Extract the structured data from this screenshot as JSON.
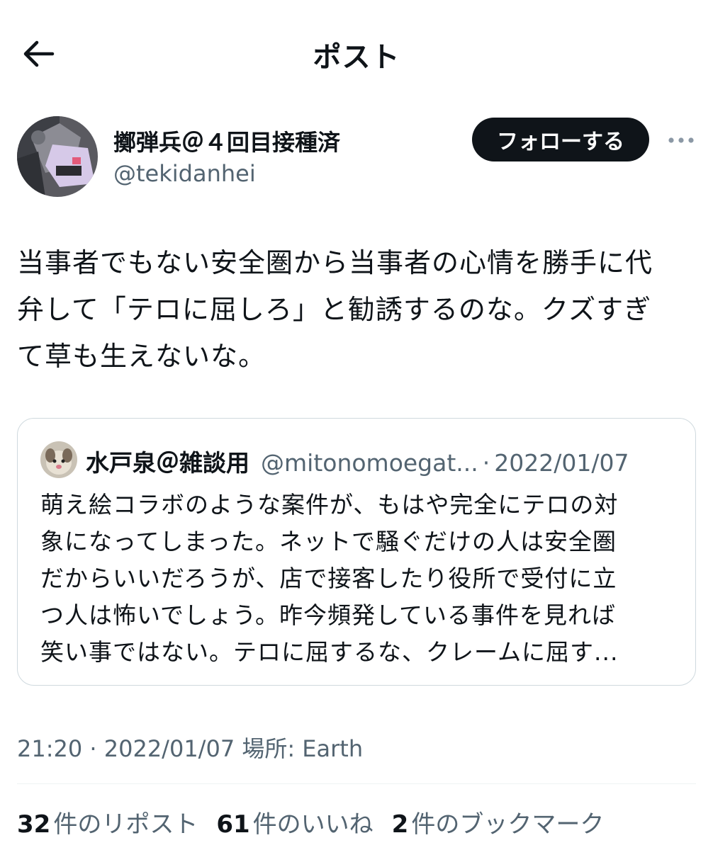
{
  "header": {
    "title": "ポスト",
    "back_icon": "arrow-left-icon"
  },
  "author": {
    "display_name": "擲弾兵＠４回目接種済",
    "handle": "@tekidanhei",
    "follow_label": "フォローする",
    "more_icon": "more-horizontal-icon"
  },
  "tweet": {
    "lines": [
      "当事者でもない安全圏から当事者の心情を勝手に代",
      "弁して「テロに屈しろ」と勧誘するのな。クズすぎ",
      "て草も生えないな。"
    ]
  },
  "quote": {
    "display_name": "水戸泉＠雑談用",
    "handle": "@mitonomoegat...",
    "separator": "·",
    "date": "2022/01/07",
    "lines": [
      "萌え絵コラボのような案件が、もはや完全にテロの対",
      "象になってしまった。ネットで騒ぐだけの人は安全圏",
      "だからいいだろうが、店で接客したり役所で受付に立",
      "つ人は怖いでしょう。昨今頻発している事件を見れば",
      "笑い事ではない。テロに屈するな、クレームに屈す..."
    ]
  },
  "meta": {
    "time": "21:20",
    "separator": "·",
    "date": "2022/01/07",
    "location": "場所: Earth"
  },
  "stats": {
    "reposts_count": "32",
    "reposts_label": "件のリポスト",
    "likes_count": "61",
    "likes_label": "件のいいね",
    "bookmarks_count": "2",
    "bookmarks_label": "件のブックマーク"
  },
  "colors": {
    "text": "#0f1419",
    "secondary": "#536471",
    "border": "#cfd9de",
    "button_bg": "#0f1419"
  }
}
